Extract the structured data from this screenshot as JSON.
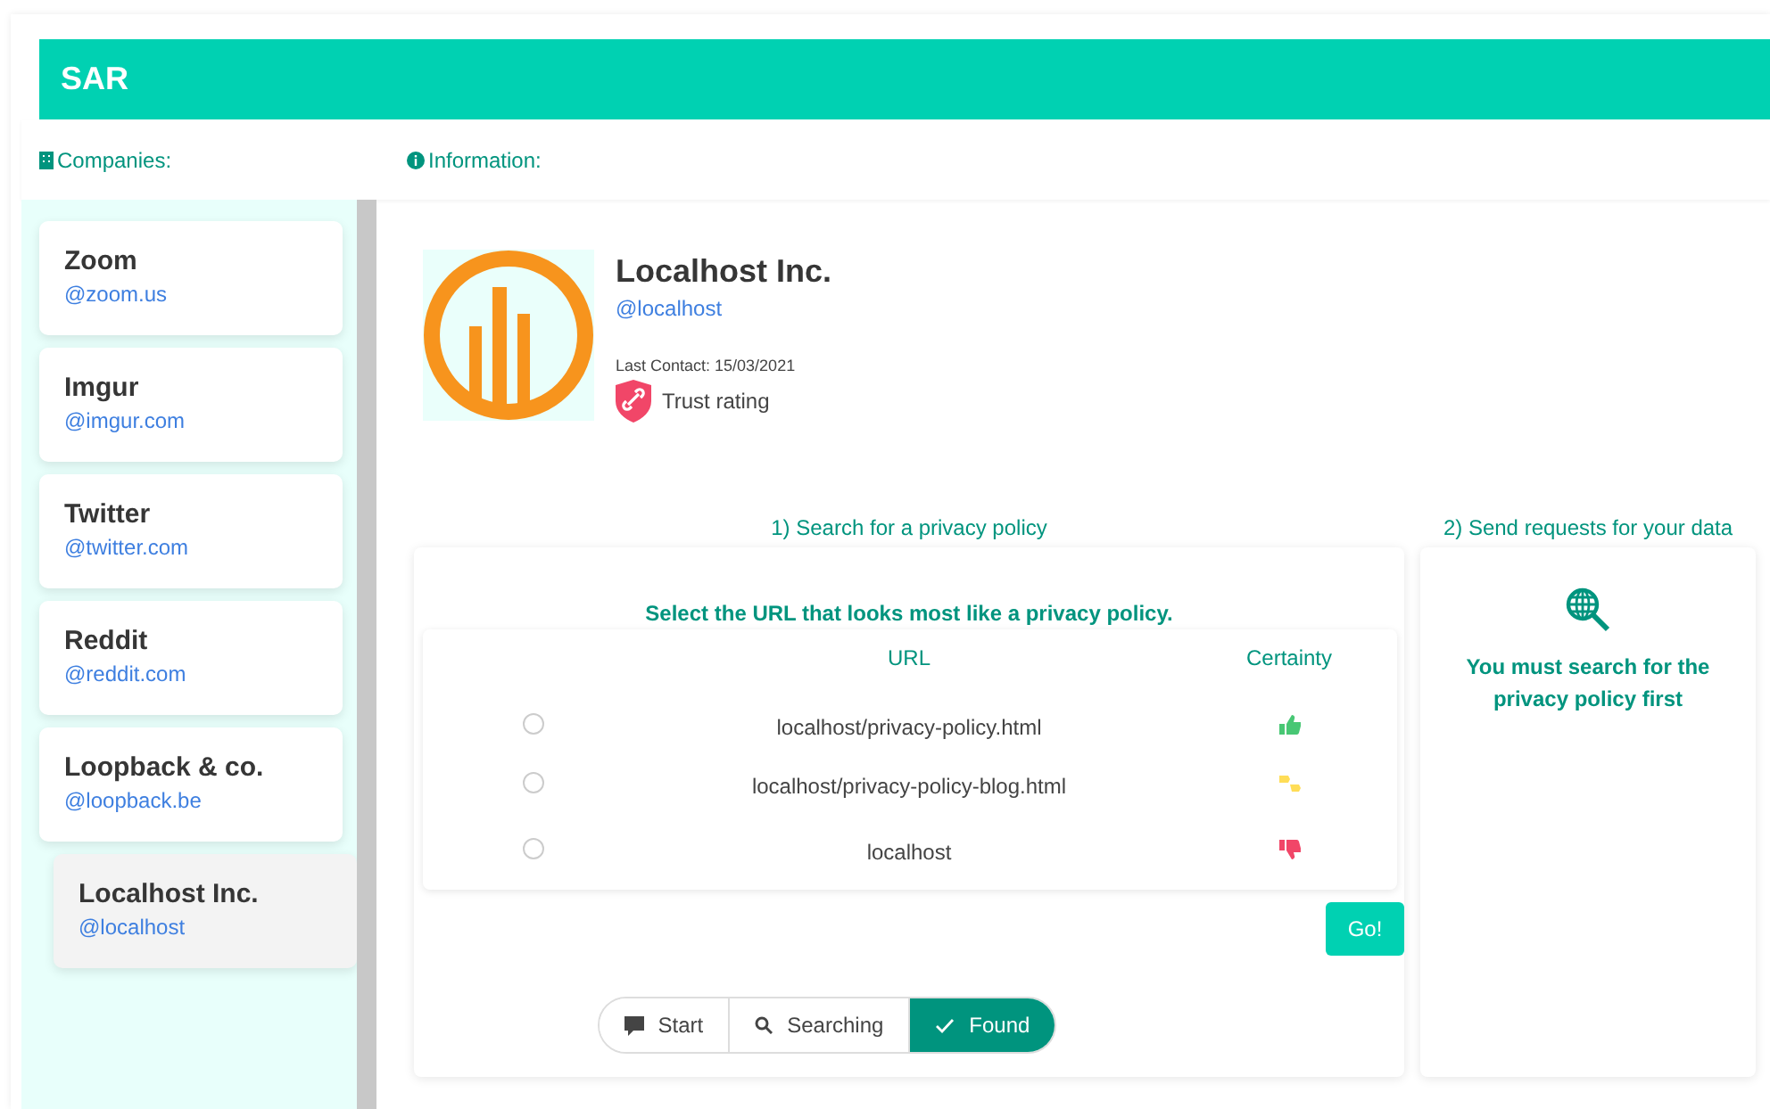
{
  "header": {
    "title": "SAR"
  },
  "labels": {
    "companies": "Companies:",
    "information": "Information:"
  },
  "companies": [
    {
      "name": "Zoom",
      "handle": "@zoom.us",
      "selected": false
    },
    {
      "name": "Imgur",
      "handle": "@imgur.com",
      "selected": false
    },
    {
      "name": "Twitter",
      "handle": "@twitter.com",
      "selected": false
    },
    {
      "name": "Reddit",
      "handle": "@reddit.com",
      "selected": false
    },
    {
      "name": "Loopback & co.",
      "handle": "@loopback.be",
      "selected": false
    },
    {
      "name": "Localhost Inc.",
      "handle": "@localhost",
      "selected": true
    }
  ],
  "info": {
    "name": "Localhost Inc.",
    "handle": "@localhost",
    "last_contact": "Last Contact: 15/03/2021",
    "trust": "Trust rating"
  },
  "search": {
    "heading": "1) Search for a privacy policy",
    "prompt": "Select the URL that looks most like a privacy policy.",
    "columns": [
      "URL",
      "Certainty"
    ],
    "rows": [
      {
        "url": "localhost/privacy-policy.html",
        "kind": "good",
        "checked": false
      },
      {
        "url": "localhost/privacy-policy-blog.html",
        "kind": "unsure",
        "checked": false
      },
      {
        "url": "localhost",
        "kind": "bad",
        "checked": false
      }
    ],
    "go": "Go!",
    "steps": [
      {
        "label": "Start",
        "kind": "start",
        "selected": false
      },
      {
        "label": "Searching",
        "kind": "searching",
        "selected": false
      },
      {
        "label": "Found",
        "kind": "found",
        "selected": true
      }
    ]
  },
  "requests": {
    "heading": "2) Send requests for your data",
    "message": "You must search for the privacy policy first"
  }
}
